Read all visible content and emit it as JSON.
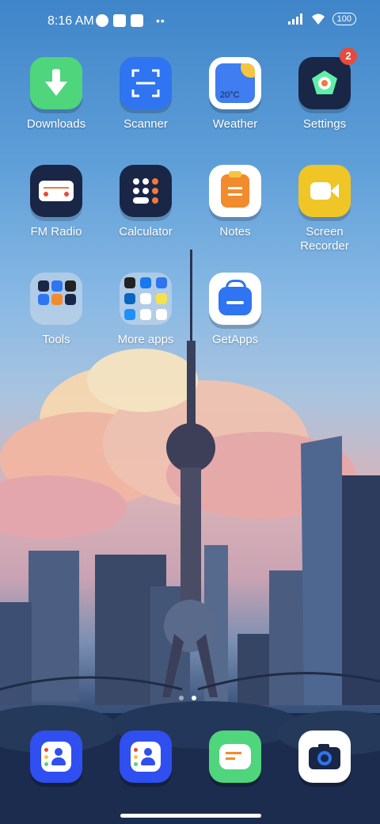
{
  "status_bar": {
    "time": "8:16 AM",
    "battery": "100"
  },
  "apps": {
    "downloads": "Downloads",
    "scanner": "Scanner",
    "weather": "Weather",
    "weather_temp": "20°C",
    "settings": "Settings",
    "settings_badge": "2",
    "fm_radio": "FM Radio",
    "calculator": "Calculator",
    "notes": "Notes",
    "screen_recorder": "Screen\nRecorder",
    "tools": "Tools",
    "more_apps": "More apps",
    "getapps": "GetApps"
  },
  "colors": {
    "downloads": "#4fd57c",
    "scanner": "#2f74f0",
    "settings": "#1a2646",
    "fm_radio": "#1a2646",
    "calculator": "#1a2646",
    "notes": "#f28b2d",
    "screen_recorder": "#f0c526",
    "dock_contacts": "#2f4ff0",
    "dock_messages": "#4fd57c"
  },
  "page_indicator": {
    "count": 2,
    "active": 2
  }
}
